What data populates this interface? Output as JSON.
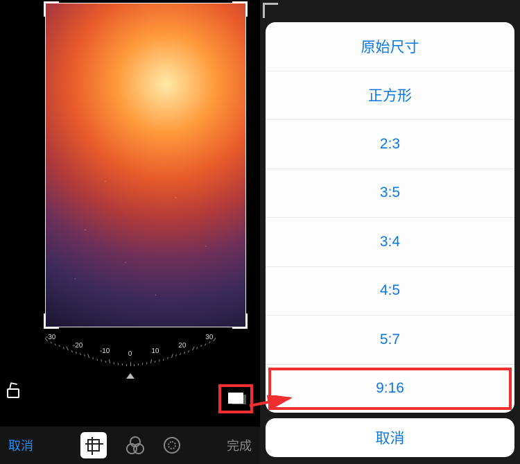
{
  "editor": {
    "cancel_label": "取消",
    "done_label": "完成",
    "dial_labels": [
      "-30",
      "-20",
      "-10",
      "0",
      "10",
      "20",
      "30"
    ]
  },
  "aspect_menu": {
    "items": [
      {
        "label": "原始尺寸"
      },
      {
        "label": "正方形"
      },
      {
        "label": "2:3"
      },
      {
        "label": "3:5"
      },
      {
        "label": "3:4"
      },
      {
        "label": "4:5"
      },
      {
        "label": "5:7"
      },
      {
        "label": "9:16"
      }
    ],
    "cancel_label": "取消",
    "highlighted_index": 7
  }
}
